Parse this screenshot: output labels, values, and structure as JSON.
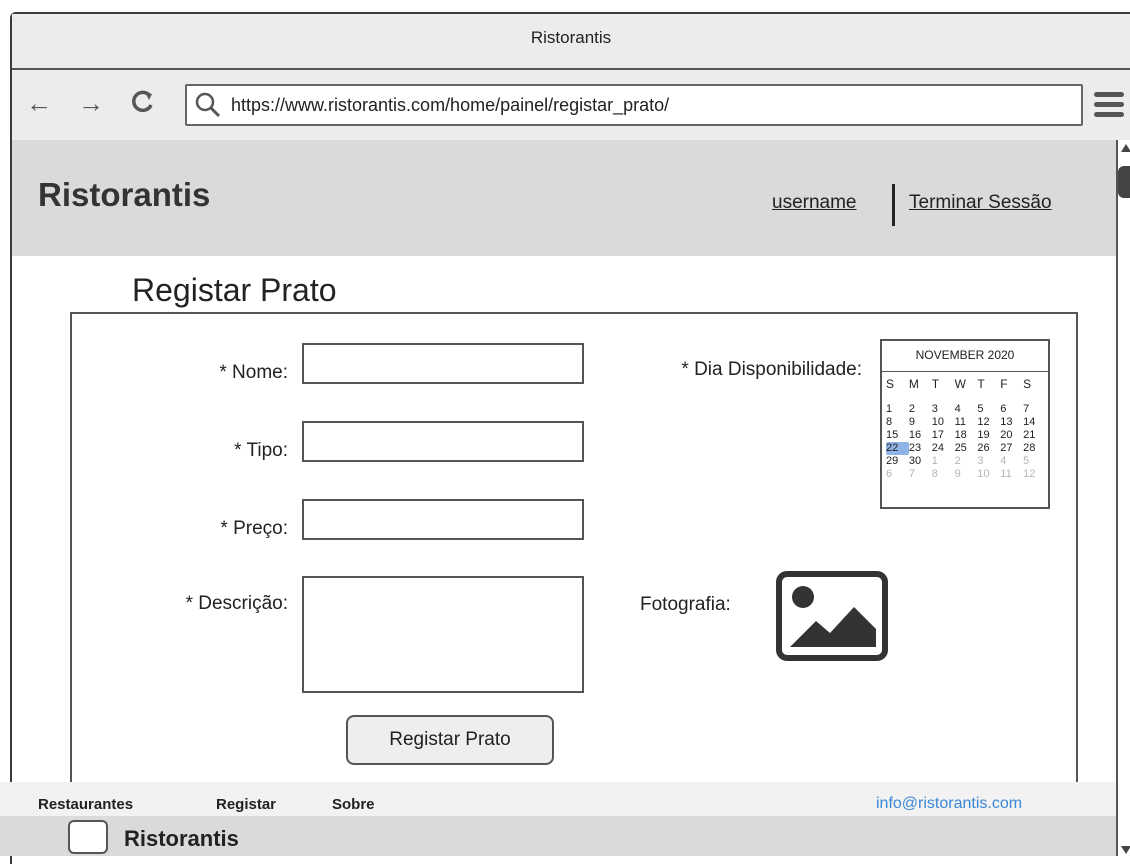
{
  "window": {
    "title": "Ristorantis"
  },
  "browser": {
    "back_icon": "←",
    "forward_icon": "→",
    "reload_icon": "C",
    "url": "https://www.ristorantis.com/home/painel/registar_prato/"
  },
  "header": {
    "logo": "Ristorantis",
    "username": "username",
    "logout": "Terminar Sessão"
  },
  "form": {
    "title": "Registar Prato",
    "fields": {
      "nome": {
        "label": "* Nome:",
        "value": ""
      },
      "tipo": {
        "label": "* Tipo:",
        "value": ""
      },
      "preco": {
        "label": "* Preço:",
        "value": ""
      },
      "descricao": {
        "label": "* Descrição:",
        "value": ""
      }
    },
    "dia_label": "* Dia Disponibilidade:",
    "foto_label": "Fotografia:",
    "submit": "Registar Prato"
  },
  "calendar": {
    "month": "NOVEMBER 2020",
    "weekdays": [
      "S",
      "M",
      "T",
      "W",
      "T",
      "F",
      "S"
    ],
    "selected": "22",
    "days": [
      "1",
      "2",
      "3",
      "4",
      "5",
      "6",
      "7",
      "8",
      "9",
      "10",
      "11",
      "12",
      "13",
      "14",
      "15",
      "16",
      "17",
      "18",
      "19",
      "20",
      "21",
      "22",
      "23",
      "24",
      "25",
      "26",
      "27",
      "28",
      "29",
      "30"
    ],
    "next_days": [
      "1",
      "2",
      "3",
      "4",
      "5",
      "6",
      "7",
      "8",
      "9",
      "10",
      "11",
      "12"
    ]
  },
  "footer": {
    "links": [
      "Restaurantes",
      "Registar",
      "Sobre"
    ],
    "email": "info@ristorantis.com",
    "brand": "Ristorantis"
  }
}
